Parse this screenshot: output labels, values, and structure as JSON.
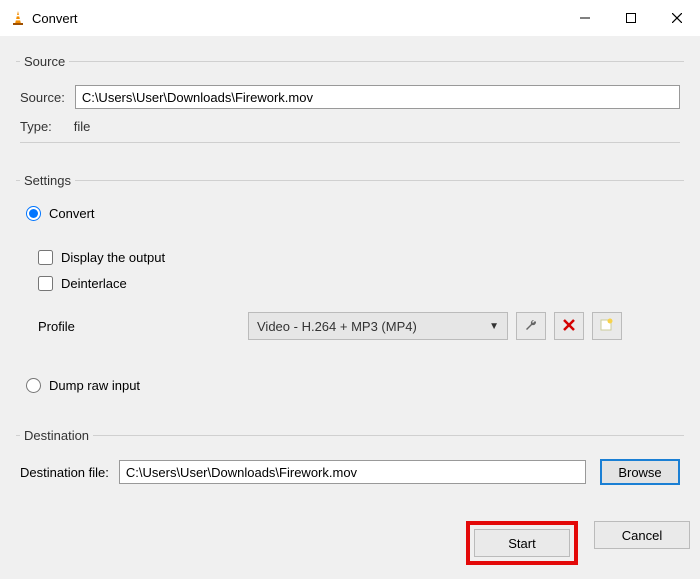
{
  "window": {
    "title": "Convert"
  },
  "source": {
    "legend": "Source",
    "label": "Source:",
    "value": "C:\\Users\\User\\Downloads\\Firework.mov",
    "type_label": "Type:",
    "type_value": "file"
  },
  "settings": {
    "legend": "Settings",
    "convert_label": "Convert",
    "display_output_label": "Display the output",
    "deinterlace_label": "Deinterlace",
    "profile_label": "Profile",
    "profile_value": "Video - H.264 + MP3 (MP4)",
    "dump_label": "Dump raw input"
  },
  "destination": {
    "legend": "Destination",
    "label": "Destination file:",
    "value": "C:\\Users\\User\\Downloads\\Firework.mov",
    "browse_label": "Browse"
  },
  "footer": {
    "start_label": "Start",
    "cancel_label": "Cancel"
  },
  "icons": {
    "wrench": "wrench-icon",
    "delete": "delete-icon",
    "new": "new-profile-icon"
  }
}
